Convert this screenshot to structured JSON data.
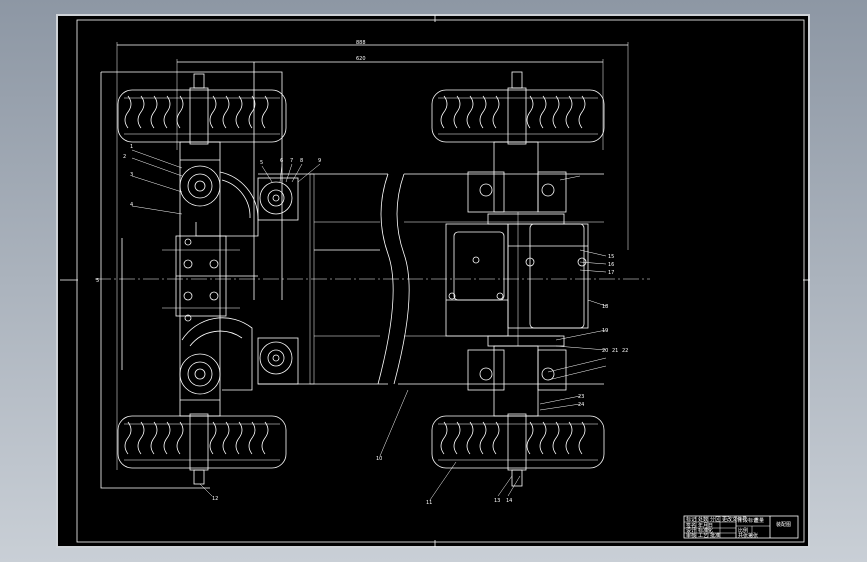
{
  "viewer": {
    "background": "#b4bcc6",
    "sheet_color": "#000000",
    "line_color": "#ffffff"
  },
  "drawing": {
    "dim_top": "888",
    "dim_top2": "620",
    "dim_left": "5",
    "part_labels": [
      "1",
      "2",
      "3",
      "4",
      "5",
      "6",
      "7",
      "8",
      "9",
      "10",
      "11",
      "12",
      "13",
      "14",
      "15",
      "16",
      "17",
      "18",
      "19",
      "20",
      "21",
      "22",
      "23",
      "24"
    ]
  },
  "title_block": {
    "cells": [
      "标记",
      "处数",
      "分区",
      "更改文件号",
      "签名",
      "年月日",
      "设计",
      "标准化",
      "阶段标记",
      "重量",
      "比例",
      "审核",
      "工艺",
      "批准",
      "共张第张",
      "装配图"
    ]
  }
}
